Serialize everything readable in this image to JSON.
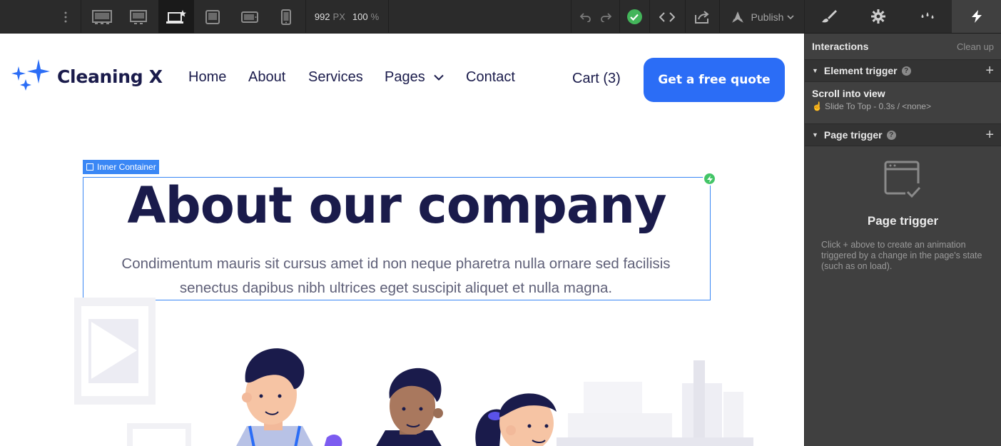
{
  "toolbar": {
    "viewport_width": "992",
    "viewport_unit": "PX",
    "zoom": "100",
    "zoom_unit": "%",
    "publish_label": "Publish",
    "icons": [
      "more-vert-icon",
      "desktop-large-icon",
      "desktop-icon",
      "laptop-base-icon",
      "tablet-landscape-icon",
      "tablet-portrait-icon",
      "phone-icon",
      "undo-icon",
      "redo-icon",
      "check-icon",
      "code-icon",
      "export-icon",
      "publish-rocket-icon"
    ]
  },
  "panel": {
    "tabs": [
      "style-brush-icon",
      "settings-gear-icon",
      "effects-drops-icon",
      "interactions-bolt-icon"
    ],
    "heading": "Interactions",
    "cleanup": "Clean up",
    "element_trigger": {
      "label": "Element trigger",
      "item_title": "Scroll into view",
      "item_detail": "Slide To Top - 0.3s / <none>"
    },
    "page_trigger": {
      "label": "Page trigger",
      "empty_title": "Page trigger",
      "empty_desc": "Click + above to create an animation triggered by a change in the page's state (such as on load)."
    }
  },
  "site": {
    "brand": "Cleaning X",
    "nav": [
      "Home",
      "About",
      "Services",
      "Pages",
      "Contact"
    ],
    "cart": "Cart (3)",
    "cta": "Get a free quote",
    "selection_label": "Inner Container",
    "hero_title": "About our company",
    "hero_sub_line1": "Condimentum mauris sit cursus amet id non neque pharetra nulla ornare sed facilisis",
    "hero_sub_line2": "senectus dapibus nibh ultrices eget suscipit aliquet et nulla magna.",
    "colors": {
      "brand_navy": "#1a1b4b",
      "accent_blue": "#2b6df6",
      "selection_blue": "#3a87f5",
      "success_green": "#43b55a"
    }
  }
}
